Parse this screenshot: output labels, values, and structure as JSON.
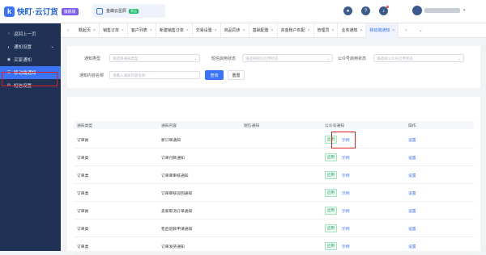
{
  "brand": {
    "name": "快盯·云订货",
    "badge": "旗舰版"
  },
  "store": {
    "name": "金蝶云星辰",
    "tag": "营运"
  },
  "colors": {
    "primary": "#3b73f6",
    "sidebar": "#1f3256",
    "highlight": "#e02020"
  },
  "sidebar": {
    "back": "返回上一页",
    "group": "通知设置",
    "items": [
      {
        "label": "买家通知",
        "icon": "dot-icon"
      },
      {
        "label": "移动端通知",
        "icon": "list-icon",
        "active": true
      },
      {
        "label": "短信设置",
        "icon": "mail-icon"
      }
    ]
  },
  "tabs": [
    {
      "label": "概起页"
    },
    {
      "label": "销售订单"
    },
    {
      "label": "客户列表"
    },
    {
      "label": "新建销售订单"
    },
    {
      "label": "交易设置"
    },
    {
      "label": "商品同步"
    },
    {
      "label": "基础配置"
    },
    {
      "label": "资金账户匹配"
    },
    {
      "label": "管理员"
    },
    {
      "label": "业务通知"
    },
    {
      "label": "移动端通知",
      "active": true
    }
  ],
  "filters": {
    "type_label": "通知类型",
    "type_placeholder": "请选择通知类型",
    "status_label": "短信启用状态",
    "status_placeholder": "请选择短信启用状态",
    "official_label": "公众号启用状态",
    "official_placeholder": "请选择公众号启用状态",
    "name_label": "通知内容名称",
    "name_placeholder": "请输入通知内容名称",
    "query": "查询",
    "reset": "重置"
  },
  "table": {
    "headers": [
      "通知类型",
      "通知内容",
      "短信通知",
      "公众号通知",
      "操作"
    ],
    "enabled": "启用",
    "example": "示例",
    "action": "设置",
    "rows": [
      {
        "type": "订单类",
        "content": "新订单通知"
      },
      {
        "type": "订单类",
        "content": "订单付款通知"
      },
      {
        "type": "订单类",
        "content": "订单审审核通知"
      },
      {
        "type": "订单类",
        "content": "订单审核驳回通知"
      },
      {
        "type": "订单类",
        "content": "卖家取消订单通知"
      },
      {
        "type": "订单类",
        "content": "售后退款申请通知"
      },
      {
        "type": "订单类",
        "content": "订单发货通知"
      }
    ]
  }
}
